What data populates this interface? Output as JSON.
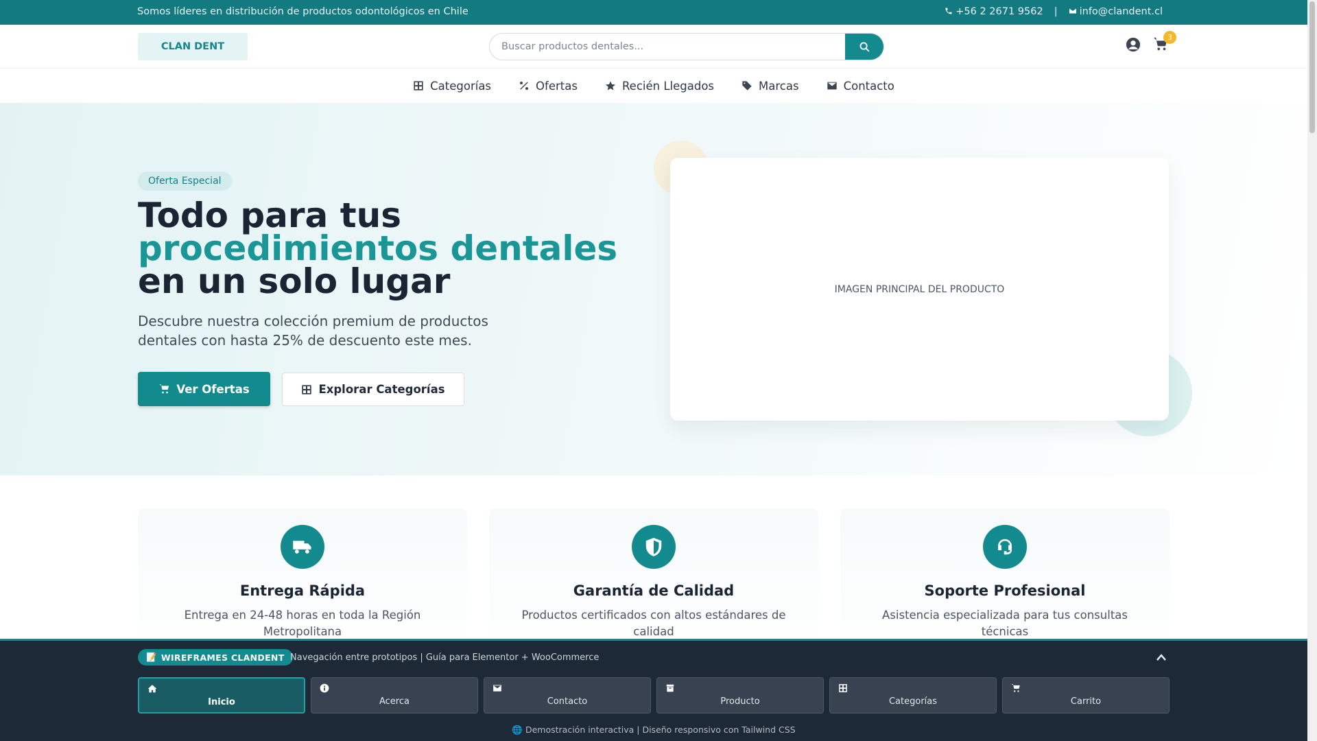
{
  "topbar": {
    "tagline": "Somos líderes en distribución de productos odontológicos en Chile",
    "phone": "+56 2 2671 9562",
    "separator": "|",
    "email": "info@clandent.cl"
  },
  "header": {
    "logo": "CLAN DENT",
    "search_placeholder": "Buscar productos dentales...",
    "cart_count": "3"
  },
  "nav": {
    "items": [
      {
        "label": "Categorías",
        "icon": "grid-icon"
      },
      {
        "label": "Ofertas",
        "icon": "percent-icon"
      },
      {
        "label": "Recién Llegados",
        "icon": "star-icon"
      },
      {
        "label": "Marcas",
        "icon": "tag-icon"
      },
      {
        "label": "Contacto",
        "icon": "envelope-icon"
      }
    ]
  },
  "hero": {
    "pill": "Oferta Especial",
    "title_line1": "Todo para tus",
    "title_accent": "procedimientos dentales",
    "title_line3": "en un solo lugar",
    "lead": "Descubre nuestra colección premium de productos dentales con hasta 25% de descuento este mes.",
    "primary_button": "Ver Ofertas",
    "secondary_button": "Explorar Categorías",
    "image_placeholder": "IMAGEN PRINCIPAL DEL PRODUCTO"
  },
  "features": [
    {
      "title": "Entrega Rápida",
      "text": "Entrega en 24-48 horas en toda la Región Metropolitana",
      "icon": "truck-icon"
    },
    {
      "title": "Garantía de Calidad",
      "text": "Productos certificados con altos estándares de calidad",
      "icon": "shield-icon"
    },
    {
      "title": "Soporte Profesional",
      "text": "Asistencia especializada para tus consultas técnicas",
      "icon": "headset-icon"
    }
  ],
  "panel": {
    "tag": "WIREFRAMES CLANDENT",
    "tag_icon": "📝",
    "subtitle": "Navegación entre prototipos | Guía para Elementor + WooCommerce",
    "prototypes": [
      {
        "label": "Inicio",
        "icon": "home-icon",
        "active": true
      },
      {
        "label": "Acerca",
        "icon": "info-icon",
        "active": false
      },
      {
        "label": "Contacto",
        "icon": "envelope-icon",
        "active": false
      },
      {
        "label": "Producto",
        "icon": "box-icon",
        "active": false
      },
      {
        "label": "Categorías",
        "icon": "grid-icon",
        "active": false
      },
      {
        "label": "Carrito",
        "icon": "cart-icon",
        "active": false
      }
    ],
    "footer_icon": "🌐",
    "footer": "Demostración interactiva | Diseño responsivo con Tailwind CSS"
  },
  "colors": {
    "brand": "#138a8e",
    "accent_text": "#1b9696",
    "badge": "#f5b82a",
    "panel_bg": "#1e2937"
  }
}
